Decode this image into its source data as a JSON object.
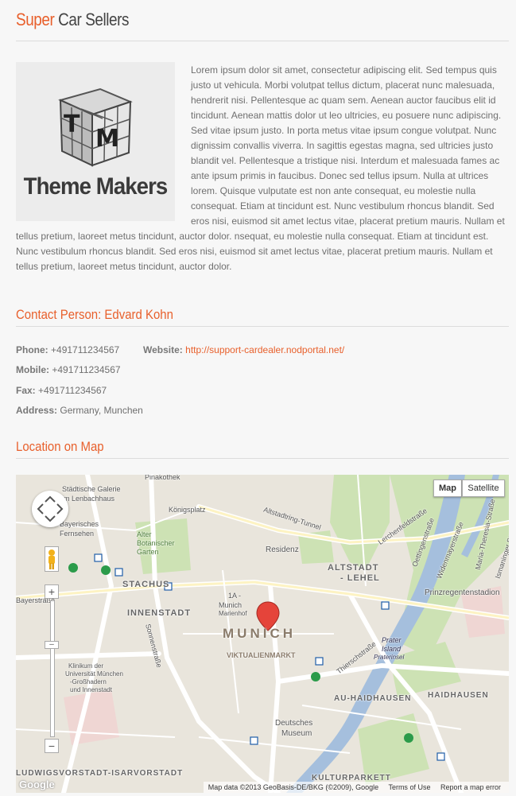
{
  "header": {
    "title_accent": "Super",
    "title_rest": "Car Sellers"
  },
  "logo": {
    "text": "Theme Makers"
  },
  "intro": {
    "paragraph": "Lorem ipsum dolor sit amet, consectetur adipiscing elit. Sed tempus quis justo ut vehicula. Morbi volutpat tellus dictum, placerat nunc malesuada, hendrerit nisi. Pellentesque ac quam sem. Aenean auctor faucibus elit id tincidunt. Aenean mattis dolor ut leo ultricies, eu posuere nunc adipiscing. Sed vitae ipsum justo. In porta metus vitae ipsum congue volutpat. Nunc dignissim convallis viverra. In sagittis egestas magna, sed ultricies justo blandit vel. Pellentesque a tristique nisi. Interdum et malesuada fames ac ante ipsum primis in faucibus. Donec sed tellus ipsum. Nulla at ultrices lorem. Quisque vulputate est non ante consequat, eu molestie nulla consequat. Etiam at tincidunt est. Nunc vestibulum rhoncus blandit. Sed eros nisi, euismod sit amet lectus vitae, placerat pretium mauris. Nullam et tellus pretium, laoreet metus tincidunt, auctor dolor. nsequat, eu molestie nulla consequat. Etiam at tincidunt est. Nunc vestibulum rhoncus blandit. Sed eros nisi, euismod sit amet lectus vitae, placerat pretium mauris. Nullam et tellus pretium, laoreet metus tincidunt, auctor dolor."
  },
  "contact": {
    "heading": "Contact Person: Edvard Kohn",
    "phone_label": "Phone:",
    "phone": "+491711234567",
    "website_label": "Website:",
    "website": "http://support-cardealer.nodportal.net/",
    "mobile_label": "Mobile:",
    "mobile": "+491711234567",
    "fax_label": "Fax:",
    "fax": "+491711234567",
    "address_label": "Address:",
    "address": "Germany, Munchen"
  },
  "location": {
    "heading": "Location on Map",
    "map_button": "Map",
    "satellite_button": "Satellite",
    "labels": {
      "pinakothek": "Pinakothek",
      "galerie1": "Städtische Galerie",
      "galerie2": "im Lenbachhaus",
      "koenigsplatz": "Königsplatz",
      "fernsehen1": "Bayerisches",
      "fernsehen2": "Fernsehen",
      "alter1": "Alter",
      "alter2": "Botanischer",
      "alter3": "Garten",
      "residenz": "Residenz",
      "altstadt1": "ALTSTADT",
      "altstadt2": "- LEHEL",
      "stachus": "STACHUS",
      "bayerstrasse": "Bayerstraße",
      "innenstadt": "INNENSTADT",
      "marienhof1": "1A -",
      "marienhof2": "Munich",
      "marienhof3": "Marienhof",
      "munich": "MUNICH",
      "viktualien": "VIKTUALIENMARKT",
      "prinzregenten": "Prinzregentenstadion",
      "prater1": "Prater",
      "prater2": "Island",
      "prater3": "Praterinsel",
      "klinikum1": "Klinikum der",
      "klinikum2": "Universität München",
      "klinikum3": "-Großhadern",
      "klinikum4": "und Innenstadt",
      "au": "AU-HAIDHAUSEN",
      "haidhausen": "HAIDHAUSEN",
      "museum1": "Deutsches",
      "museum2": "Museum",
      "isarvorstadt": "LUDWIGSVORSTADT-ISARVORSTADT",
      "kulturparkett": "KULTURPARKETT",
      "altstadtring": "Altstadtring-Tunnel",
      "sonnen": "Sonnenstraße",
      "thiersch": "Thierschstraße",
      "oettingen": "Oettingenstraße",
      "widenmayer": "Widenmayerstraße",
      "lerchenfeld": "Lerchenfeldstraße",
      "maria": "Maria-Theresia-Straße",
      "ismaninger": "Ismaninger Straße"
    },
    "footer": {
      "attribution": "Map data ©2013 GeoBasis-DE/BKG (©2009), Google",
      "terms": "Terms of Use",
      "report": "Report a map error"
    },
    "google_logo": "Google"
  }
}
